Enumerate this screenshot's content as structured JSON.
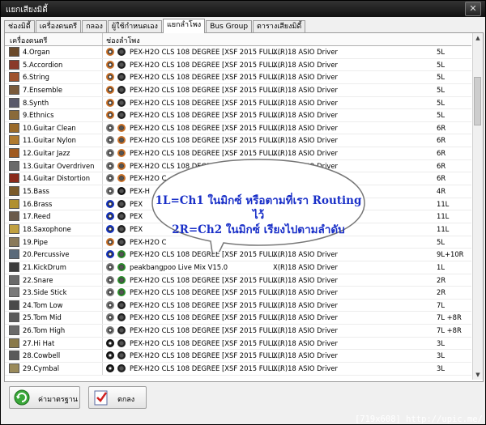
{
  "window": {
    "title": "แยกเสียงมิดี้",
    "close_label": "✕"
  },
  "tabs": [
    "ช่องมิดี้",
    "เครื่องดนตรี",
    "กลอง",
    "ผู้ใช้กำหนดเอง",
    "แยกลำโพง",
    "Bus Group",
    "ตารางเสียงมิดี้"
  ],
  "table": {
    "headers": [
      "เครื่องดนตรี",
      "ช่องลำโพง"
    ],
    "rows": [
      {
        "name": "4.Organ",
        "device": "PEX-H2O CLS 108 DEGREE [XSF 2015 FULL...",
        "driver": "X(R)18 ASIO Driver",
        "channel": "5L",
        "k1": "#c87028",
        "k2": "#202020",
        "icon": "#6b4a2a"
      },
      {
        "name": "5.Accordion",
        "device": "PEX-H2O CLS 108 DEGREE [XSF 2015 FULL...",
        "driver": "X(R)18 ASIO Driver",
        "channel": "5L",
        "k1": "#c87028",
        "k2": "#202020",
        "icon": "#8a3a2a"
      },
      {
        "name": "6.String",
        "device": "PEX-H2O CLS 108 DEGREE [XSF 2015 FULL...",
        "driver": "X(R)18 ASIO Driver",
        "channel": "5L",
        "k1": "#c87028",
        "k2": "#202020",
        "icon": "#a0522d"
      },
      {
        "name": "7.Ensemble",
        "device": "PEX-H2O CLS 108 DEGREE [XSF 2015 FULL...",
        "driver": "X(R)18 ASIO Driver",
        "channel": "5L",
        "k1": "#c87028",
        "k2": "#202020",
        "icon": "#7a5a3a"
      },
      {
        "name": "8.Synth",
        "device": "PEX-H2O CLS 108 DEGREE [XSF 2015 FULL...",
        "driver": "X(R)18 ASIO Driver",
        "channel": "5L",
        "k1": "#c87028",
        "k2": "#202020",
        "icon": "#5a5a6a"
      },
      {
        "name": "9.Ethnics",
        "device": "PEX-H2O CLS 108 DEGREE [XSF 2015 FULL...",
        "driver": "X(R)18 ASIO Driver",
        "channel": "5L",
        "k1": "#c87028",
        "k2": "#202020",
        "icon": "#8a6a3a"
      },
      {
        "name": "10.Guitar Clean",
        "device": "PEX-H2O CLS 108 DEGREE [XSF 2015 FULL...",
        "driver": "X(R)18 ASIO Driver",
        "channel": "6R",
        "k1": "#7a7a7a",
        "k2": "#c87028",
        "icon": "#9a6a2a"
      },
      {
        "name": "11.Guitar Nylon",
        "device": "PEX-H2O CLS 108 DEGREE [XSF 2015 FULL...",
        "driver": "X(R)18 ASIO Driver",
        "channel": "6R",
        "k1": "#7a7a7a",
        "k2": "#c87028",
        "icon": "#b07a30"
      },
      {
        "name": "12.Guitar Jazz",
        "device": "PEX-H2O CLS 108 DEGREE [XSF 2015 FULL...",
        "driver": "X(R)18 ASIO Driver",
        "channel": "6R",
        "k1": "#7a7a7a",
        "k2": "#c87028",
        "icon": "#a05a20"
      },
      {
        "name": "13.Guitar Overdriven",
        "device": "PEX-H2O CLS 108 DEGREE [XSF 2015 FULL...",
        "driver": "X(R)18 ASIO Driver",
        "channel": "6R",
        "k1": "#7a7a7a",
        "k2": "#c87028",
        "icon": "#6a6a6a"
      },
      {
        "name": "14.Guitar Distortion",
        "device": "PEX-H2O C",
        "driver": "",
        "channel": "6R",
        "k1": "#7a7a7a",
        "k2": "#c87028",
        "icon": "#8a2a1a"
      },
      {
        "name": "15.Bass",
        "device": "PEX-H",
        "driver": "",
        "channel": "4R",
        "k1": "#7a7a7a",
        "k2": "#101010",
        "icon": "#7a5a2a"
      },
      {
        "name": "16.Brass",
        "device": "PEX",
        "driver": "",
        "channel": "11L",
        "k1": "#1030c0",
        "k2": "#202020",
        "icon": "#b09030"
      },
      {
        "name": "17.Reed",
        "device": "PEX",
        "driver": "",
        "channel": "11L",
        "k1": "#1030c0",
        "k2": "#202020",
        "icon": "#6a5a4a"
      },
      {
        "name": "18.Saxophone",
        "device": "PEX",
        "driver": "",
        "channel": "11L",
        "k1": "#1030c0",
        "k2": "#202020",
        "icon": "#c0a040"
      },
      {
        "name": "19.Pipe",
        "device": "PEX-H2O C",
        "driver": "",
        "channel": "5L",
        "k1": "#c87028",
        "k2": "#202020",
        "icon": "#8a7a5a"
      },
      {
        "name": "20.Percussive",
        "device": "PEX-H2O CLS 108 DEGREE [XSF 2015 FULL...",
        "driver": "X(R)18 ASIO Driver",
        "channel": "9L+10R",
        "k1": "#1030c0",
        "k2": "#2a8a2a",
        "icon": "#5a6a7a"
      },
      {
        "name": "21.KickDrum",
        "device": "peakbangpoo Live Mix V15.0",
        "driver": "X(R)18 ASIO Driver",
        "channel": "1L",
        "k1": "#7a7a7a",
        "k2": "#2a8a2a",
        "icon": "#3a3a3a"
      },
      {
        "name": "22.Snare",
        "device": "PEX-H2O CLS 108 DEGREE [XSF 2015 FULL...",
        "driver": "X(R)18 ASIO Driver",
        "channel": "2R",
        "k1": "#7a7a7a",
        "k2": "#2a8a2a",
        "icon": "#6a6a6a"
      },
      {
        "name": "23.Side Stick",
        "device": "PEX-H2O CLS 108 DEGREE [XSF 2015 FULL...",
        "driver": "X(R)18 ASIO Driver",
        "channel": "2R",
        "k1": "#7a7a7a",
        "k2": "#2a8a2a",
        "icon": "#7a7a7a"
      },
      {
        "name": "24.Tom Low",
        "device": "PEX-H2O CLS 108 DEGREE [XSF 2015 FULL...",
        "driver": "X(R)18 ASIO Driver",
        "channel": "7L",
        "k1": "#7a7a7a",
        "k2": "#202020",
        "icon": "#4a4a4a"
      },
      {
        "name": "25.Tom Mid",
        "device": "PEX-H2O CLS 108 DEGREE [XSF 2015 FULL...",
        "driver": "X(R)18 ASIO Driver",
        "channel": "7L +8R",
        "k1": "#7a7a7a",
        "k2": "#202020",
        "icon": "#5a5a5a"
      },
      {
        "name": "26.Tom High",
        "device": "PEX-H2O CLS 108 DEGREE [XSF 2015 FULL...",
        "driver": "X(R)18 ASIO Driver",
        "channel": "7L +8R",
        "k1": "#7a7a7a",
        "k2": "#202020",
        "icon": "#6a6a6a"
      },
      {
        "name": "27.Hi Hat",
        "device": "PEX-H2O CLS 108 DEGREE [XSF 2015 FULL...",
        "driver": "X(R)18 ASIO Driver",
        "channel": "3L",
        "k1": "#101010",
        "k2": "#202020",
        "icon": "#8a7a4a"
      },
      {
        "name": "28.Cowbell",
        "device": "PEX-H2O CLS 108 DEGREE [XSF 2015 FULL...",
        "driver": "X(R)18 ASIO Driver",
        "channel": "3L",
        "k1": "#101010",
        "k2": "#202020",
        "icon": "#5a5a5a"
      },
      {
        "name": "29.Cymbal",
        "device": "PEX-H2O CLS 108 DEGREE [XSF 2015 FULL...",
        "driver": "X(R)18 ASIO Driver",
        "channel": "3L",
        "k1": "#101010",
        "k2": "#202020",
        "icon": "#9a8a5a"
      }
    ]
  },
  "bubble": {
    "line1": "1L=Ch1 ในมิกซ์ หรือตามที่เรา Routing ไว้",
    "line2": "2R=Ch2 ในมิกซ์ เรียงไปตามลำดับ",
    "text_color": "#1a30c8"
  },
  "buttons": {
    "default_label": "ค่ามาตรฐาน",
    "ok_label": "ตกลง"
  },
  "watermark": "[719x608] http://upic.me/"
}
